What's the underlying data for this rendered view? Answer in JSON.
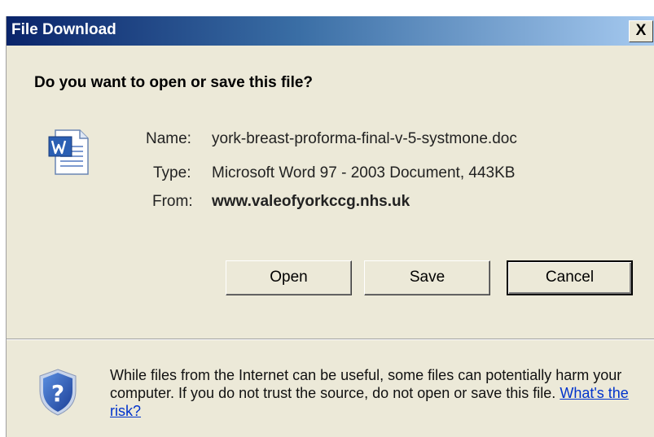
{
  "window": {
    "title": "File Download",
    "close_glyph": "X"
  },
  "dialog": {
    "question": "Do you want to open or save this file?",
    "file_icon": "word-document-icon",
    "fields": {
      "name_label": "Name:",
      "name_value": "york-breast-proforma-final-v-5-systmone.doc",
      "type_label": "Type:",
      "type_value": "Microsoft Word 97 - 2003 Document, 443KB",
      "from_label": "From:",
      "from_value": "www.valeofyorkccg.nhs.uk"
    },
    "buttons": {
      "open": "Open",
      "save": "Save",
      "cancel": "Cancel"
    },
    "warning": {
      "icon": "security-shield-question-icon",
      "text": "While files from the Internet can be useful, some files can potentially harm your computer. If you do not trust the source, do not open or save this file.",
      "link": "What's the risk?"
    }
  },
  "colors": {
    "titlebar_start": "#0a246a",
    "titlebar_end": "#a6caf0",
    "dialog_bg": "#ece9d8",
    "link": "#0033cc"
  }
}
